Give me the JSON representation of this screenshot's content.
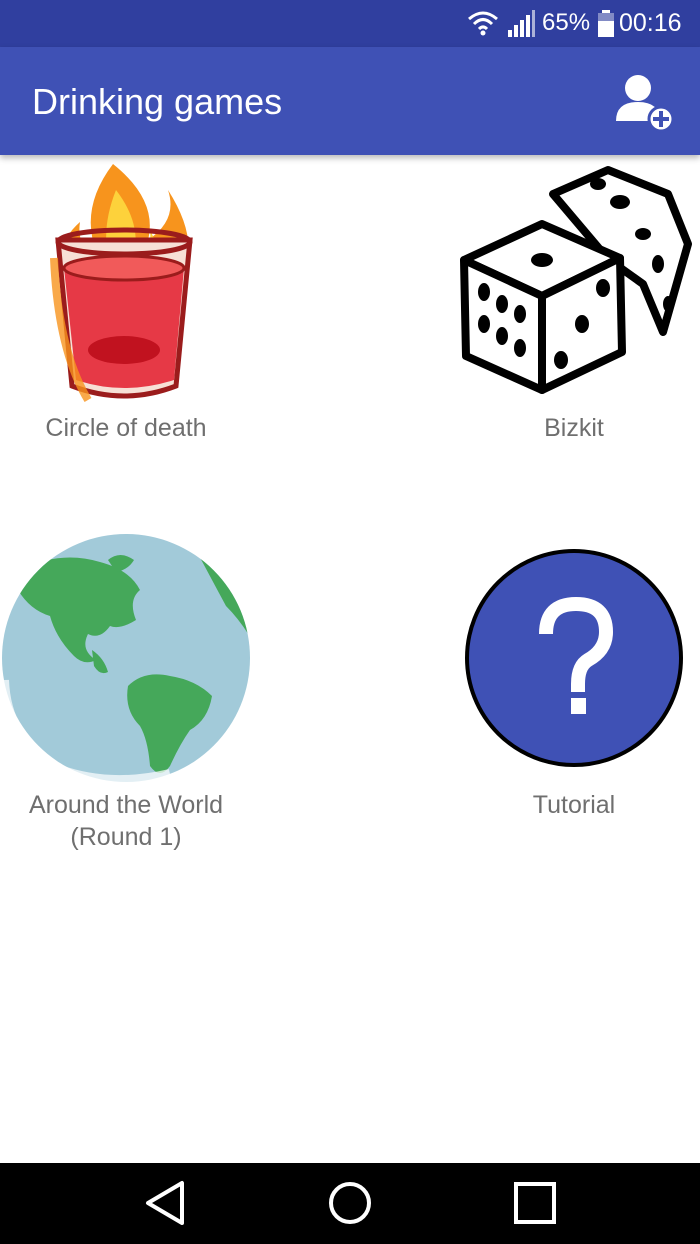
{
  "status_bar": {
    "battery_percent": "65%",
    "time": "00:16",
    "icons": [
      "wifi-icon",
      "signal-icon",
      "battery-icon"
    ]
  },
  "app_bar": {
    "title": "Drinking games",
    "action_icon": "add-player-icon"
  },
  "games": [
    {
      "label": "Circle of death",
      "icon": "flaming-shot-icon"
    },
    {
      "label": "Bizkit",
      "icon": "dice-icon"
    },
    {
      "label_line1": "Around the World",
      "label_line2": "(Round 1)",
      "icon": "globe-icon"
    },
    {
      "label": "Tutorial",
      "icon": "help-question-icon"
    }
  ],
  "nav_bar": {
    "buttons": [
      "back-icon",
      "home-icon",
      "recents-icon"
    ]
  },
  "colors": {
    "status_bar": "#303f9f",
    "app_bar": "#3f51b5",
    "label_text": "#6f6f6f",
    "tutorial_circle": "#3f51b5",
    "globe_ocean": "#a2cad9",
    "globe_land": "#45a85a"
  }
}
